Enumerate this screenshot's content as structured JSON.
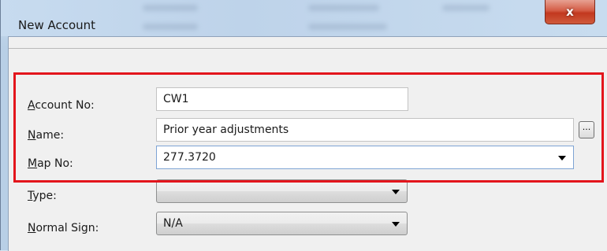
{
  "window": {
    "title": "New Account",
    "close_label": "x"
  },
  "form": {
    "account_no": {
      "label_ul": "A",
      "label_rest": "ccount No:",
      "value": "CW1"
    },
    "name": {
      "label_ul": "N",
      "label_rest": "ame:",
      "value": "Prior year adjustments",
      "browse_label": "..."
    },
    "map_no": {
      "label_ul": "M",
      "label_rest": "ap No:",
      "value": "277.3720"
    },
    "type": {
      "label_ul": "T",
      "label_rest": "ype:",
      "value": ""
    },
    "normal_sign": {
      "label_ul": "N",
      "label_rest": "ormal Sign:",
      "value": "N/A"
    }
  },
  "colors": {
    "highlight": "#e3151c",
    "close_button": "#c2381f"
  },
  "icons": [
    "close-icon",
    "dropdown-arrow-icon",
    "ellipsis-icon"
  ]
}
